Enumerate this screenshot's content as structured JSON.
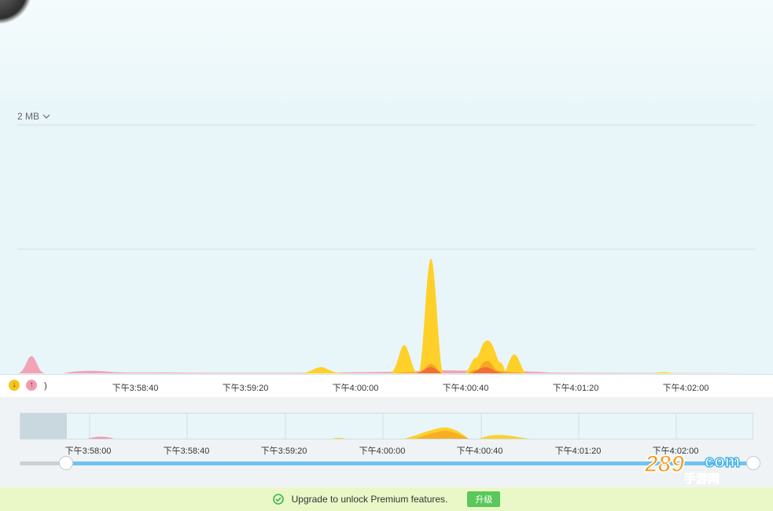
{
  "scale": {
    "label": "2 MB"
  },
  "legend": {
    "download_icon": "arrow-down-icon",
    "download_glyph": "↓",
    "upload_icon": "arrow-up-icon",
    "upload_glyph": "↑"
  },
  "main_axis": {
    "edge_label": ")",
    "ticks": [
      "下午3:58:40",
      "下午3:59:20",
      "下午4:00:00",
      "下午4:00:40",
      "下午4:01:20",
      "下午4:02:00"
    ]
  },
  "overview_axis": {
    "ticks": [
      "下午3:58:00",
      "下午3:58:40",
      "下午3:59:20",
      "下午4:00:00",
      "下午4:00:40",
      "下午4:01:20",
      "下午4:02:00"
    ]
  },
  "upgrade": {
    "message": "Upgrade to unlock Premium features.",
    "button_label": "升级"
  },
  "watermark": {
    "text_top": "289",
    "text_com": "com",
    "text_bottom": "手游网"
  },
  "colors": {
    "download": "#ffd02a",
    "download_dark": "#f5a623",
    "upload": "#f29bb0",
    "upload_dark": "#f0653a",
    "accent_green": "#5ac85a",
    "slider": "#6ec3ef"
  }
}
